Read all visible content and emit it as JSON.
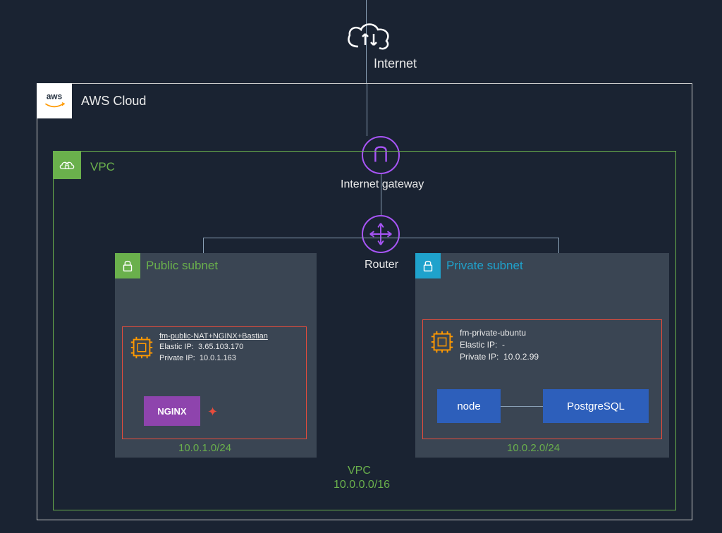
{
  "internet": {
    "label": "Internet"
  },
  "aws": {
    "title": "AWS Cloud",
    "logo_text": "aws"
  },
  "vpc": {
    "title": "VPC",
    "footer_label": "VPC",
    "cidr": "10.0.0.0/16"
  },
  "igw": {
    "label": "Internet gateway"
  },
  "router": {
    "label": "Router"
  },
  "public_subnet": {
    "title": "Public subnet",
    "cidr": "10.0.1.0/24",
    "instance": {
      "name": "fm-public-NAT+NGINX+Bastian",
      "elastic_ip_label": "Elastic IP:",
      "elastic_ip": "3.65.103.170",
      "private_ip_label": "Private IP:",
      "private_ip": "10.0.1.163"
    },
    "services": {
      "nginx": "NGINX"
    }
  },
  "private_subnet": {
    "title": "Private subnet",
    "cidr": "10.0.2.0/24",
    "instance": {
      "name": "fm-private-ubuntu",
      "elastic_ip_label": "Elastic IP:",
      "elastic_ip": "-",
      "private_ip_label": "Private IP:",
      "private_ip": "10.0.2.99"
    },
    "services": {
      "node": "node",
      "postgres": "PostgreSQL"
    }
  },
  "colors": {
    "bg": "#1a2332",
    "green": "#6ab04c",
    "cyan": "#1fa2cc",
    "purple": "#a855f7",
    "red": "#e74c3c",
    "blue": "#2d5fbb",
    "violet": "#8e44ad"
  }
}
